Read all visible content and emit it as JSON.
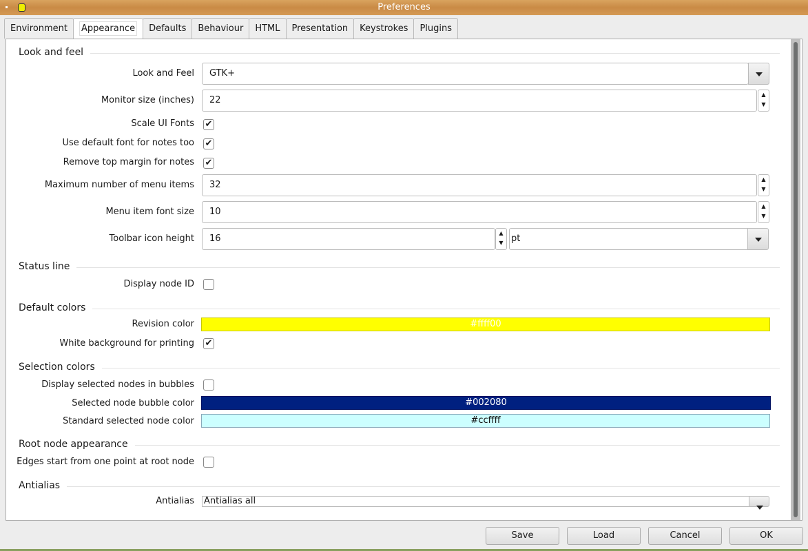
{
  "window": {
    "title": "Preferences"
  },
  "tabs": [
    "Environment",
    "Appearance",
    "Defaults",
    "Behaviour",
    "HTML",
    "Presentation",
    "Keystrokes",
    "Plugins"
  ],
  "sections": {
    "look": "Look and feel",
    "status": "Status line",
    "colors": "Default colors",
    "selection": "Selection colors",
    "root": "Root node appearance",
    "antialias": "Antialias"
  },
  "fields": {
    "look_and_feel": {
      "label": "Look and Feel",
      "value": "GTK+"
    },
    "monitor_size": {
      "label": "Monitor size (inches)",
      "value": "22"
    },
    "scale_fonts": {
      "label": "Scale UI Fonts",
      "checked": true
    },
    "default_font_notes": {
      "label": "Use default font for notes too",
      "checked": true
    },
    "remove_margin": {
      "label": "Remove top margin for notes",
      "checked": true
    },
    "max_menu_items": {
      "label": "Maximum number of menu items",
      "value": "32"
    },
    "menu_font_size": {
      "label": "Menu item font size",
      "value": "10"
    },
    "toolbar_icon_height": {
      "label": "Toolbar icon height",
      "value": "16",
      "unit": "pt"
    },
    "display_node_id": {
      "label": "Display node ID",
      "checked": false
    },
    "revision_color": {
      "label": "Revision color",
      "value": "#ffff00"
    },
    "white_bg": {
      "label": "White background for printing",
      "checked": true
    },
    "display_bubbles": {
      "label": "Display selected nodes in bubbles",
      "checked": false
    },
    "bubble_color": {
      "label": "Selected node bubble color",
      "value": "#002080"
    },
    "standard_selected": {
      "label": "Standard selected node color",
      "value": "#ccffff"
    },
    "edges_root": {
      "label": "Edges start from one point at root node",
      "checked": false
    },
    "antialias": {
      "label": "Antialias",
      "value": "Antialias all"
    }
  },
  "buttons": {
    "save": "Save",
    "load": "Load",
    "cancel": "Cancel",
    "ok": "OK"
  }
}
